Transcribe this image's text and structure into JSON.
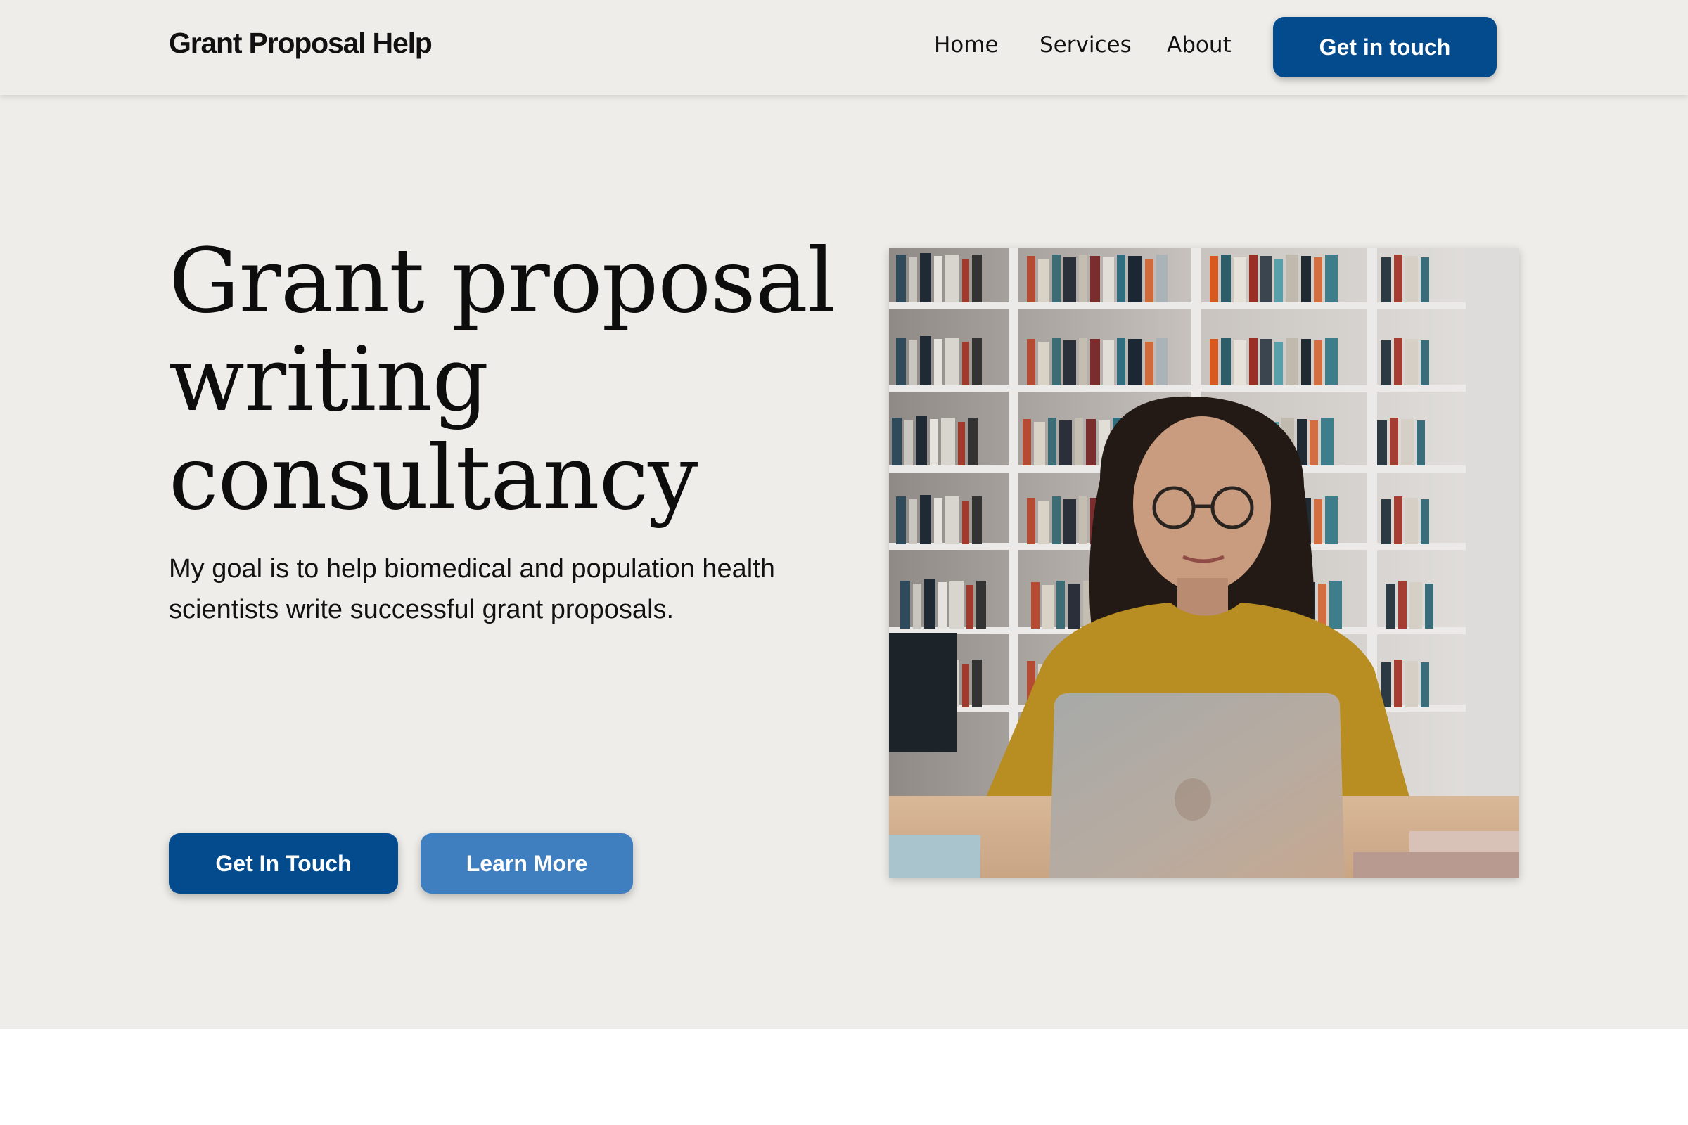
{
  "header": {
    "brand": "Grant Proposal Help",
    "nav": [
      "Home",
      "Services",
      "About"
    ],
    "cta_label": "Get in touch"
  },
  "hero": {
    "title": "Grant proposal writing consultancy",
    "subtitle": "My goal is to help biomedical and population health scientists write successful grant proposals.",
    "primary_button": "Get In Touch",
    "secondary_button": "Learn More"
  },
  "colors": {
    "page_background": "#efede9",
    "primary": "#034b8c",
    "secondary": "#3f7fc0"
  }
}
